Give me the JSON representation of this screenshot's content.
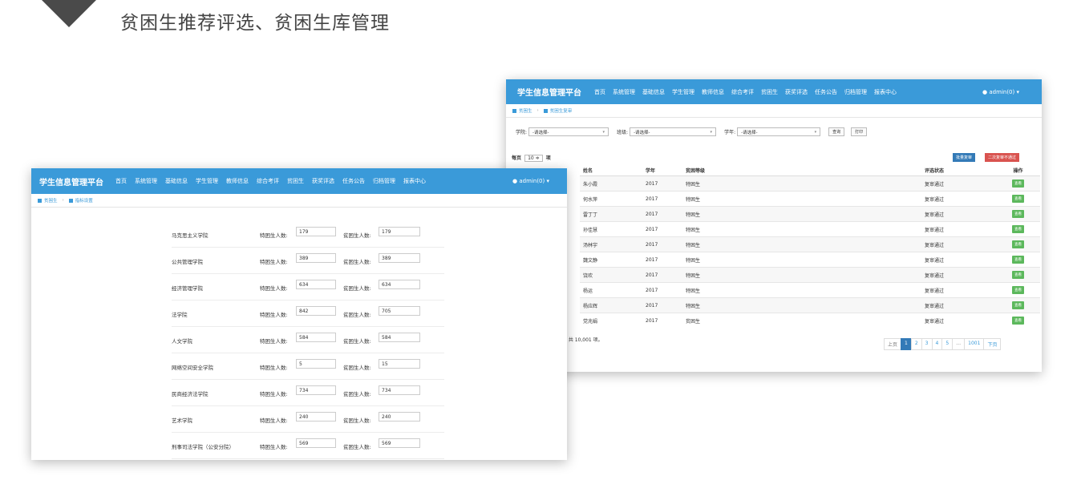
{
  "headline": "贫困生推荐评选、贫困生库管理",
  "nav": {
    "brand": "学生信息管理平台",
    "items": [
      "首页",
      "系统管理",
      "基础信息",
      "学生管理",
      "教师信息",
      "综合考评",
      "贫困生",
      "获奖评选",
      "任务公告",
      "归档管理",
      "报表中心"
    ],
    "user": "admin(0)"
  },
  "review_window": {
    "breadcrumb": {
      "root": "贫困生",
      "current": "贫困生复审"
    },
    "filters": {
      "college_label": "学院:",
      "class_label": "班级:",
      "year_label": "学年:",
      "select_placeholder": "-请选择-",
      "query_btn": "查询",
      "print_btn": "打印"
    },
    "page_size": {
      "prefix": "每页",
      "value": "10 ≑",
      "suffix": "项"
    },
    "batch_btn": "批量复审",
    "reject_btn": "二次复审不通过",
    "columns": [
      "姓名",
      "学年",
      "贫困等级",
      "评选状态",
      "操作"
    ],
    "rows": [
      {
        "name": "朱小霞",
        "year": "2017",
        "level": "特困生",
        "status": "复审通过",
        "action": "查看"
      },
      {
        "name": "何水萍",
        "year": "2017",
        "level": "特困生",
        "status": "复审通过",
        "action": "查看"
      },
      {
        "name": "雷丁丁",
        "year": "2017",
        "level": "特困生",
        "status": "复审通过",
        "action": "查看"
      },
      {
        "name": "孙佳慧",
        "year": "2017",
        "level": "特困生",
        "status": "复审通过",
        "action": "查看"
      },
      {
        "name": "汤林宇",
        "year": "2017",
        "level": "特困生",
        "status": "复审通过",
        "action": "查看"
      },
      {
        "name": "魏文静",
        "year": "2017",
        "level": "特困生",
        "status": "复审通过",
        "action": "查看"
      },
      {
        "name": "饶欢",
        "year": "2017",
        "level": "特困生",
        "status": "复审通过",
        "action": "查看"
      },
      {
        "name": "杨运",
        "year": "2017",
        "level": "特困生",
        "status": "复审通过",
        "action": "查看"
      },
      {
        "name": "杨应辉",
        "year": "2017",
        "level": "特困生",
        "status": "复审通过",
        "action": "查看"
      },
      {
        "name": "党兆娟",
        "year": "2017",
        "level": "贫困生",
        "status": "复审通过",
        "action": "查看"
      }
    ],
    "info": "项, 共 10,001 项。",
    "pager": {
      "prev": "上页",
      "pages": [
        "1",
        "2",
        "3",
        "4",
        "5"
      ],
      "ellipsis": "…",
      "last": "1001",
      "next": "下页"
    }
  },
  "quota_window": {
    "breadcrumb": {
      "root": "贫困生",
      "current": "指标设置"
    },
    "special_label": "特困生人数:",
    "poor_label": "贫困生人数:",
    "rows": [
      {
        "college": "马克思主义学院",
        "special": "179",
        "poor": "179"
      },
      {
        "college": "公共管理学院",
        "special": "389",
        "poor": "389"
      },
      {
        "college": "经济管理学院",
        "special": "634",
        "poor": "634"
      },
      {
        "college": "法学院",
        "special": "842",
        "poor": "705"
      },
      {
        "college": "人文学院",
        "special": "584",
        "poor": "584"
      },
      {
        "college": "网络空间安全学院",
        "special": "5",
        "poor": "15"
      },
      {
        "college": "民商经济法学院",
        "special": "734",
        "poor": "734"
      },
      {
        "college": "艺术学院",
        "special": "240",
        "poor": "240"
      },
      {
        "college": "刑事司法学院（公安分院）",
        "special": "569",
        "poor": "569"
      }
    ]
  },
  "colors": {
    "nav": "#3a9ad9",
    "primary": "#337ab7",
    "danger": "#d9534f",
    "success": "#5cb85c"
  }
}
